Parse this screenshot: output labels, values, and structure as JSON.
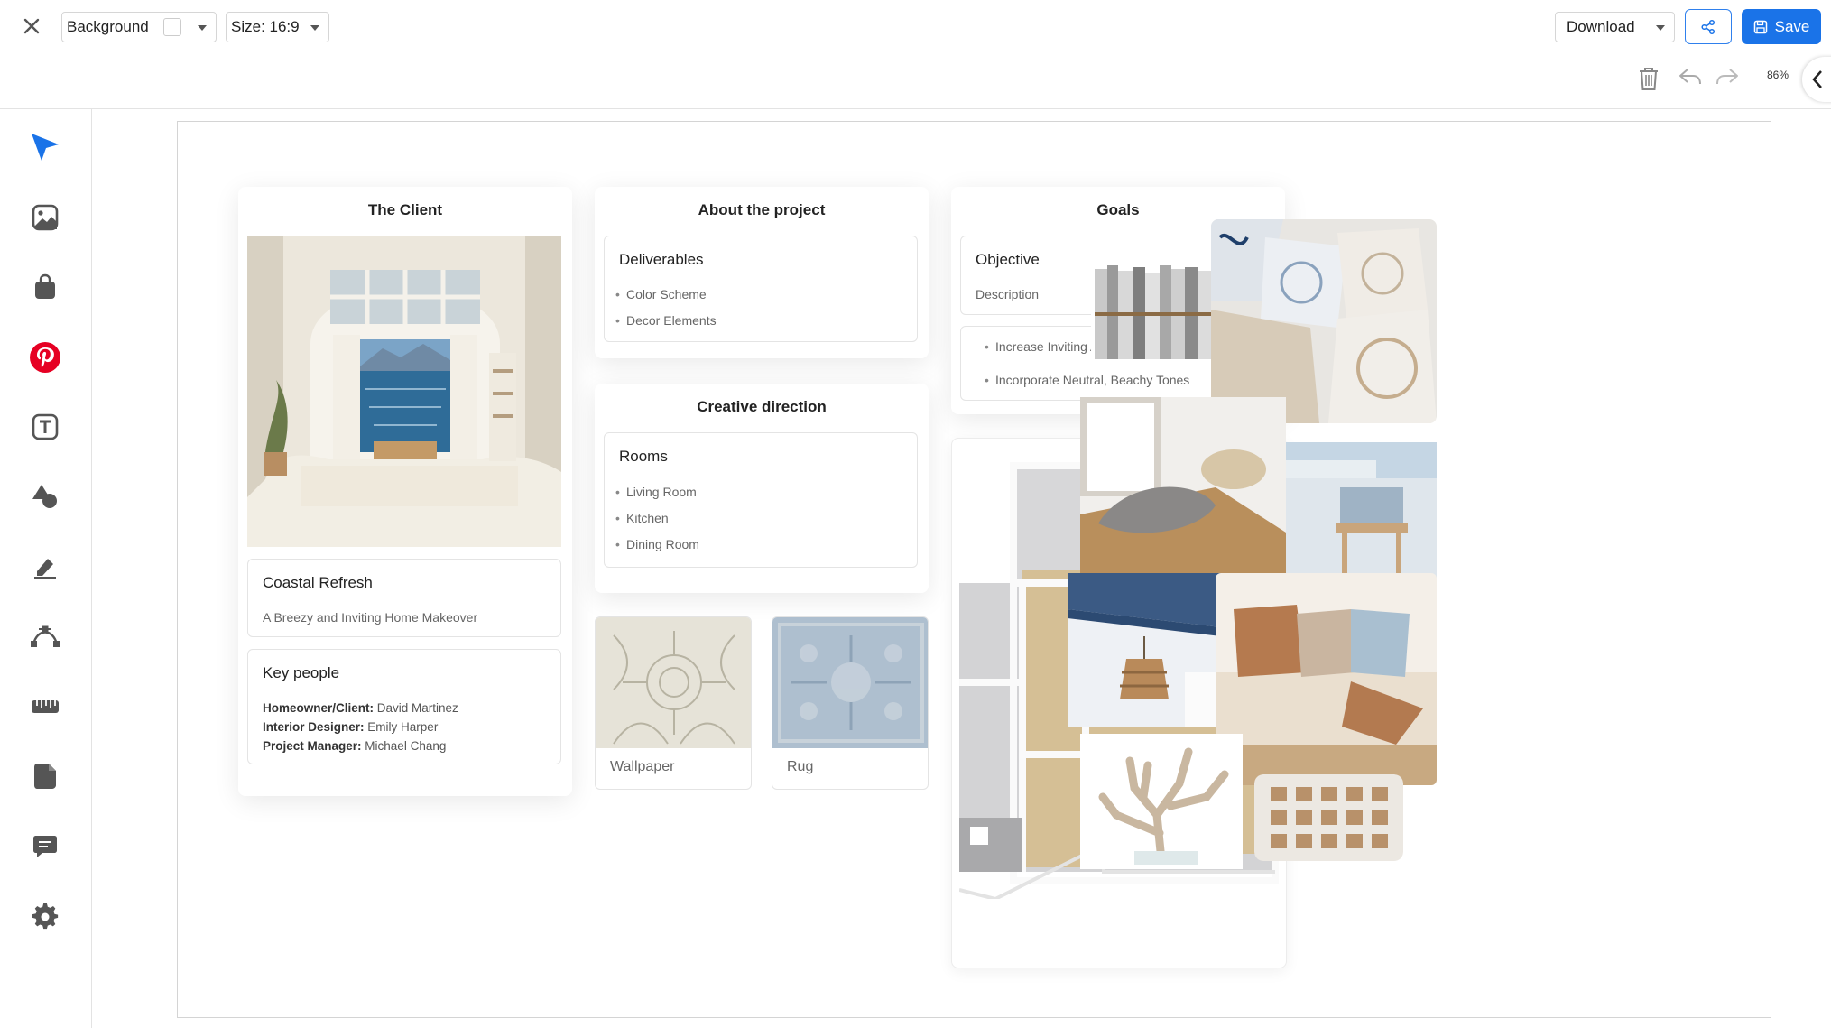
{
  "topbar": {
    "background_label": "Background",
    "size_label": "Size: 16:9",
    "download_label": "Download",
    "save_label": "Save",
    "zoom": "86%"
  },
  "client_panel": {
    "title": "The Client",
    "project_card": {
      "title": "Coastal Refresh",
      "description": "A Breezy and Inviting Home Makeover"
    },
    "people_card": {
      "title": "Key people",
      "rows": [
        {
          "role": "Homeowner/Client:",
          "name": "David Martinez"
        },
        {
          "role": "Interior Designer:",
          "name": "Emily Harper"
        },
        {
          "role": "Project Manager:",
          "name": "Michael Chang"
        }
      ]
    }
  },
  "about_panel": {
    "title": "About the project",
    "deliverables": {
      "title": "Deliverables",
      "items": [
        "Color Scheme",
        "Decor Elements"
      ]
    }
  },
  "creative_panel": {
    "title": "Creative direction",
    "rooms": {
      "title": "Rooms",
      "items": [
        "Living Room",
        "Kitchen",
        "Dining Room"
      ]
    }
  },
  "swatches": {
    "wallpaper": "Wallpaper",
    "rug": "Rug"
  },
  "goals_panel": {
    "title": "Goals",
    "objective": {
      "title": "Objective",
      "description": "Description"
    },
    "items": [
      "Increase Inviting Ambiance",
      "Incorporate Neutral, Beachy Tones"
    ]
  },
  "colors": {
    "accent": "#1a73e8",
    "pinterest": "#e60023"
  }
}
